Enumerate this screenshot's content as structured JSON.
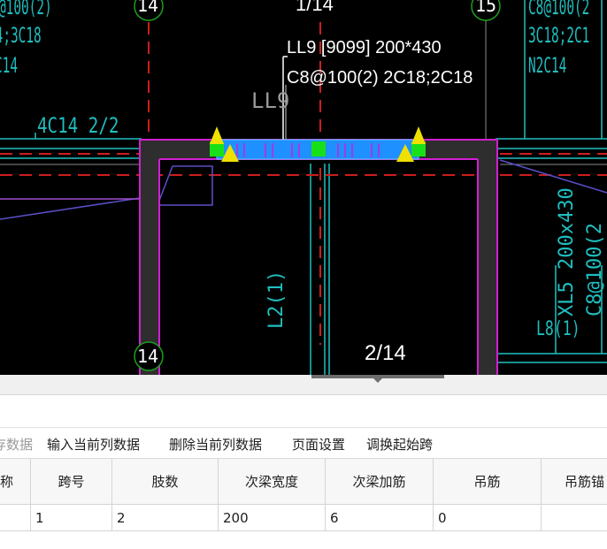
{
  "drawing": {
    "beam_label_line1": "LL9 [9099] 200*430",
    "beam_label_line2": "C8@100(2) 2C18;2C18",
    "ll9_vertical": "LL9",
    "top_left_rebar": "4C14 2/2",
    "top_left_clip_1": "@100(2)",
    "top_left_clip_2": "14;3C18",
    "top_left_clip_3": "C14",
    "top_right_clip_1": "C8@100(2",
    "top_right_clip_2": "3C18;2C1",
    "top_right_clip_3": "N2C14",
    "axis_top_1": "14",
    "axis_top_2": "1/14",
    "axis_top_3": "15",
    "axis_bottom_1": "14",
    "axis_bottom_2": "2/14",
    "l2_label": "L2(1)",
    "xl5_label": "XL5 200x430",
    "xl5_sub": "C8@100(2",
    "l8_label": "L8(1)"
  },
  "toolbar": {
    "item0": "存数据",
    "item1": "输入当前列数据",
    "item2": "删除当前列数据",
    "item3": "页面设置",
    "item4": "调换起始跨"
  },
  "table": {
    "headers": [
      "称",
      "跨号",
      "肢数",
      "次梁宽度",
      "次梁加筋",
      "吊筋",
      "吊筋锚"
    ],
    "row": [
      "",
      "1",
      "2",
      "200",
      "6",
      "0",
      ""
    ]
  },
  "colors": {
    "cad_bg": "#000000",
    "beam_blue": "#1e90ff",
    "magenta": "#d21ed2",
    "cyan": "#1fbfbf",
    "red_axis": "#cc1e1e",
    "green_marker": "#18e018",
    "yellow_marker": "#f0e000"
  }
}
